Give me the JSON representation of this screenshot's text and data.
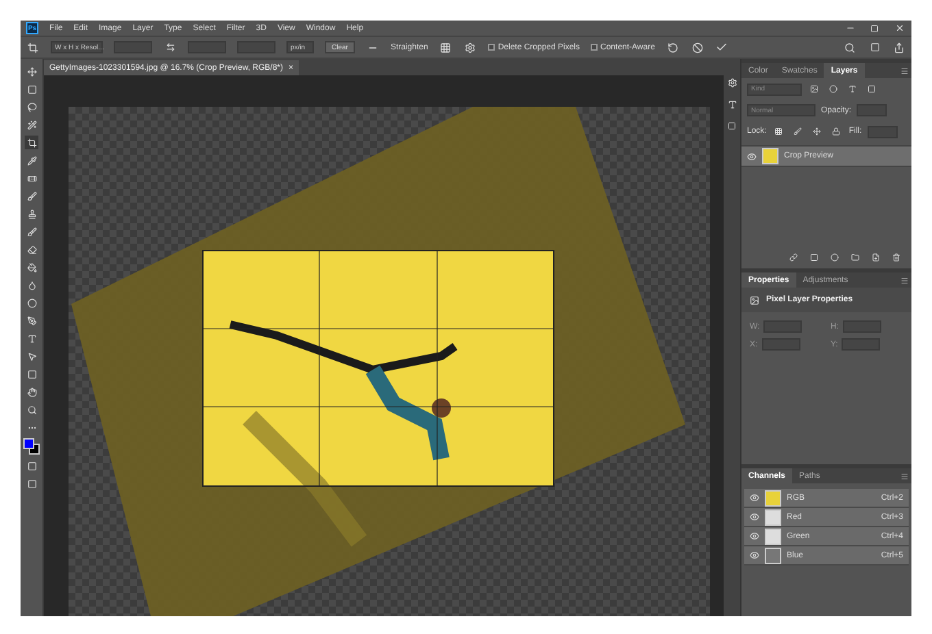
{
  "app": {
    "logo": "Ps"
  },
  "menu": [
    "File",
    "Edit",
    "Image",
    "Layer",
    "Type",
    "Select",
    "Filter",
    "3D",
    "View",
    "Window",
    "Help"
  ],
  "options_bar": {
    "ratio": "W x H x Resol...",
    "unit": "px/in",
    "clear": "Clear",
    "straighten": "Straighten",
    "checkboxes": [
      {
        "label": "Delete Cropped Pixels",
        "checked": false
      },
      {
        "label": "Content-Aware",
        "checked": false
      }
    ]
  },
  "document_tab": {
    "title": "GettyImages-1023301594.jpg @ 16.7% (Crop Preview, RGB/8*)",
    "close": "×"
  },
  "toolbar": {
    "swatches": [
      {
        "kind": "foreground",
        "color": "#0000ff"
      },
      {
        "kind": "background",
        "color": "#000000"
      }
    ]
  },
  "layers_panel": {
    "tabs": [
      {
        "label": "Color",
        "selected": false
      },
      {
        "label": "Swatches",
        "selected": false
      },
      {
        "label": "Layers",
        "selected": true
      }
    ],
    "filter_placeholder": "Kind",
    "blend_mode": "Normal",
    "opacity_label": "Opacity:",
    "lock_label": "Lock:",
    "fill_label": "Fill:",
    "layers": [
      {
        "name": "Crop Preview",
        "visible": true,
        "selected": true
      }
    ]
  },
  "properties_panel": {
    "tabs": [
      {
        "label": "Properties",
        "selected": true
      },
      {
        "label": "Adjustments",
        "selected": false
      }
    ],
    "heading": "Pixel Layer Properties",
    "fields": [
      "W:",
      "H:",
      "X:",
      "Y:"
    ]
  },
  "channels_panel": {
    "tabs": [
      {
        "label": "Channels",
        "selected": true
      },
      {
        "label": "Paths",
        "selected": false
      }
    ],
    "channels": [
      {
        "name": "RGB",
        "shortcut": "Ctrl+2",
        "visible": true,
        "kind": "color"
      },
      {
        "name": "Red",
        "shortcut": "Ctrl+3",
        "visible": true,
        "kind": "gray"
      },
      {
        "name": "Green",
        "shortcut": "Ctrl+4",
        "visible": true,
        "kind": "gray"
      },
      {
        "name": "Blue",
        "shortcut": "Ctrl+5",
        "visible": true,
        "kind": "dark"
      }
    ]
  }
}
